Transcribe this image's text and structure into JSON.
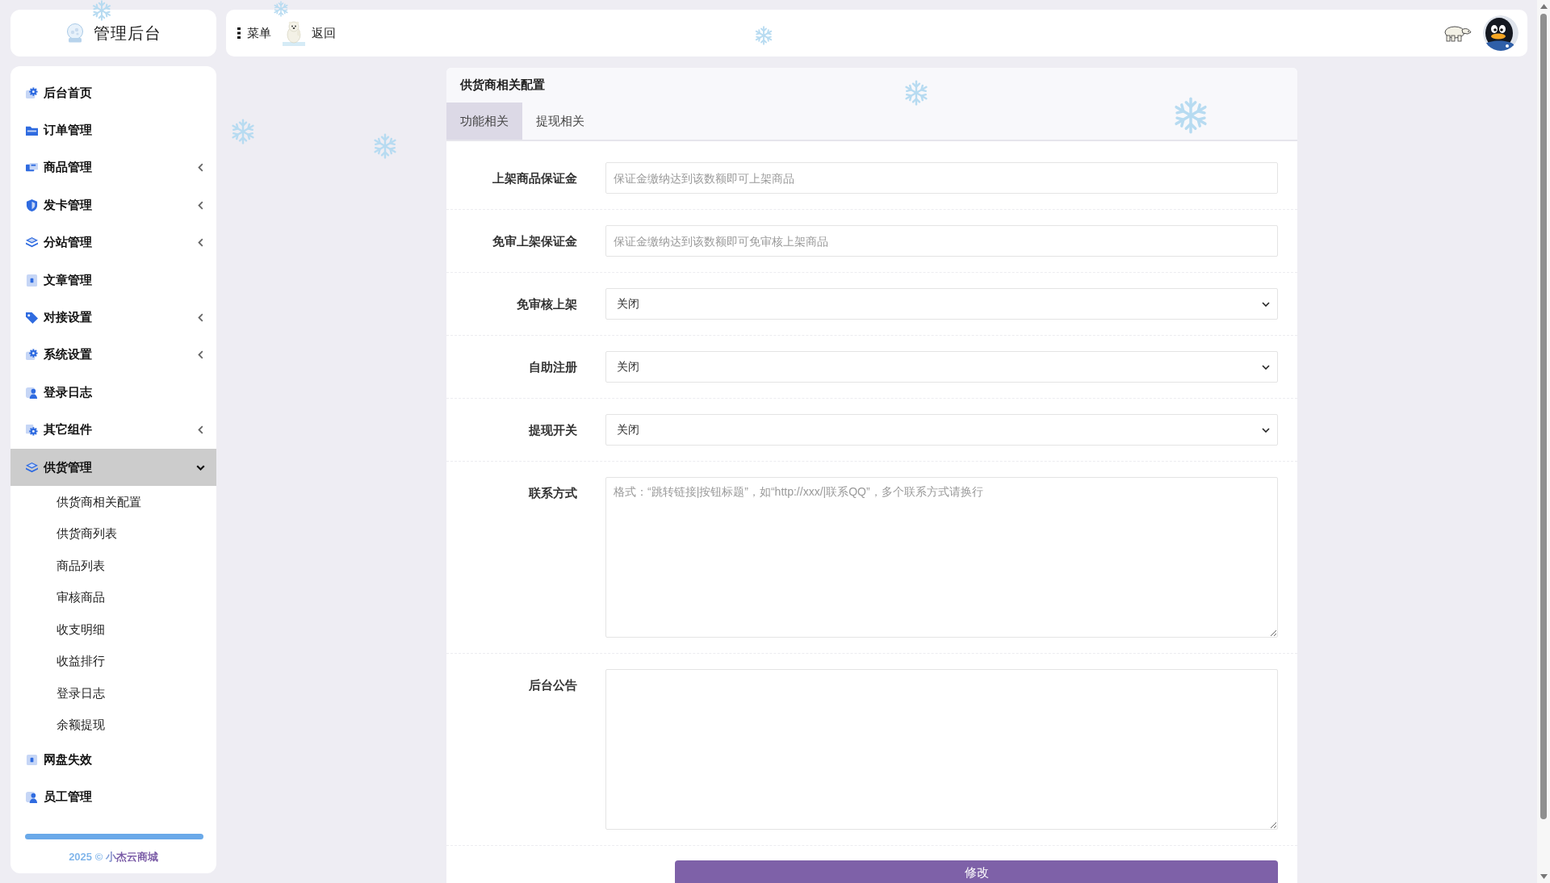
{
  "sidebar": {
    "logo_title": "管理后台",
    "items": [
      {
        "label": "后台首页",
        "kind": "link",
        "selected": false
      },
      {
        "label": "订单管理",
        "kind": "link",
        "selected": false
      },
      {
        "label": "商品管理",
        "kind": "group",
        "expanded": false,
        "selected": false
      },
      {
        "label": "发卡管理",
        "kind": "group",
        "expanded": false,
        "selected": false
      },
      {
        "label": "分站管理",
        "kind": "group",
        "expanded": false,
        "selected": false
      },
      {
        "label": "文章管理",
        "kind": "link",
        "selected": false
      },
      {
        "label": "对接设置",
        "kind": "group",
        "expanded": false,
        "selected": false
      },
      {
        "label": "系统设置",
        "kind": "group",
        "expanded": false,
        "selected": false
      },
      {
        "label": "登录日志",
        "kind": "link",
        "selected": false
      },
      {
        "label": "其它组件",
        "kind": "group",
        "expanded": false,
        "selected": false
      },
      {
        "label": "供货管理",
        "kind": "group",
        "expanded": true,
        "selected": true,
        "children": [
          {
            "label": "供货商相关配置"
          },
          {
            "label": "供货商列表"
          },
          {
            "label": "商品列表"
          },
          {
            "label": "审核商品"
          },
          {
            "label": "收支明细"
          },
          {
            "label": "收益排行"
          },
          {
            "label": "登录日志"
          },
          {
            "label": "余额提现"
          }
        ]
      },
      {
        "label": "网盘失效",
        "kind": "link",
        "selected": false
      },
      {
        "label": "员工管理",
        "kind": "link",
        "selected": false
      }
    ],
    "footer": "2025 © 小杰云商城"
  },
  "topbar": {
    "menu_button": "菜单",
    "back_button": "返回"
  },
  "panel": {
    "title": "供货商相关配置",
    "tabs": [
      {
        "label": "功能相关",
        "selected": true
      },
      {
        "label": "提现相关",
        "selected": false
      }
    ],
    "fields": [
      {
        "label": "上架商品保证金",
        "kind": "input",
        "placeholder": "保证金缴纳达到该数额即可上架商品"
      },
      {
        "label": "免审上架保证金",
        "kind": "input",
        "placeholder": "保证金缴纳达到该数额即可免审核上架商品"
      },
      {
        "label": "免审核上架",
        "kind": "select",
        "value": "关闭"
      },
      {
        "label": "自助注册",
        "kind": "select",
        "value": "关闭"
      },
      {
        "label": "提现开关",
        "kind": "select",
        "value": "关闭"
      },
      {
        "label": "联系方式",
        "kind": "textarea",
        "placeholder": "格式：“跳转链接|按钮标题”，如“http://xxx/|联系QQ”，多个联系方式请换行"
      },
      {
        "label": "后台公告",
        "kind": "textarea"
      }
    ],
    "submit_button": "修改"
  }
}
